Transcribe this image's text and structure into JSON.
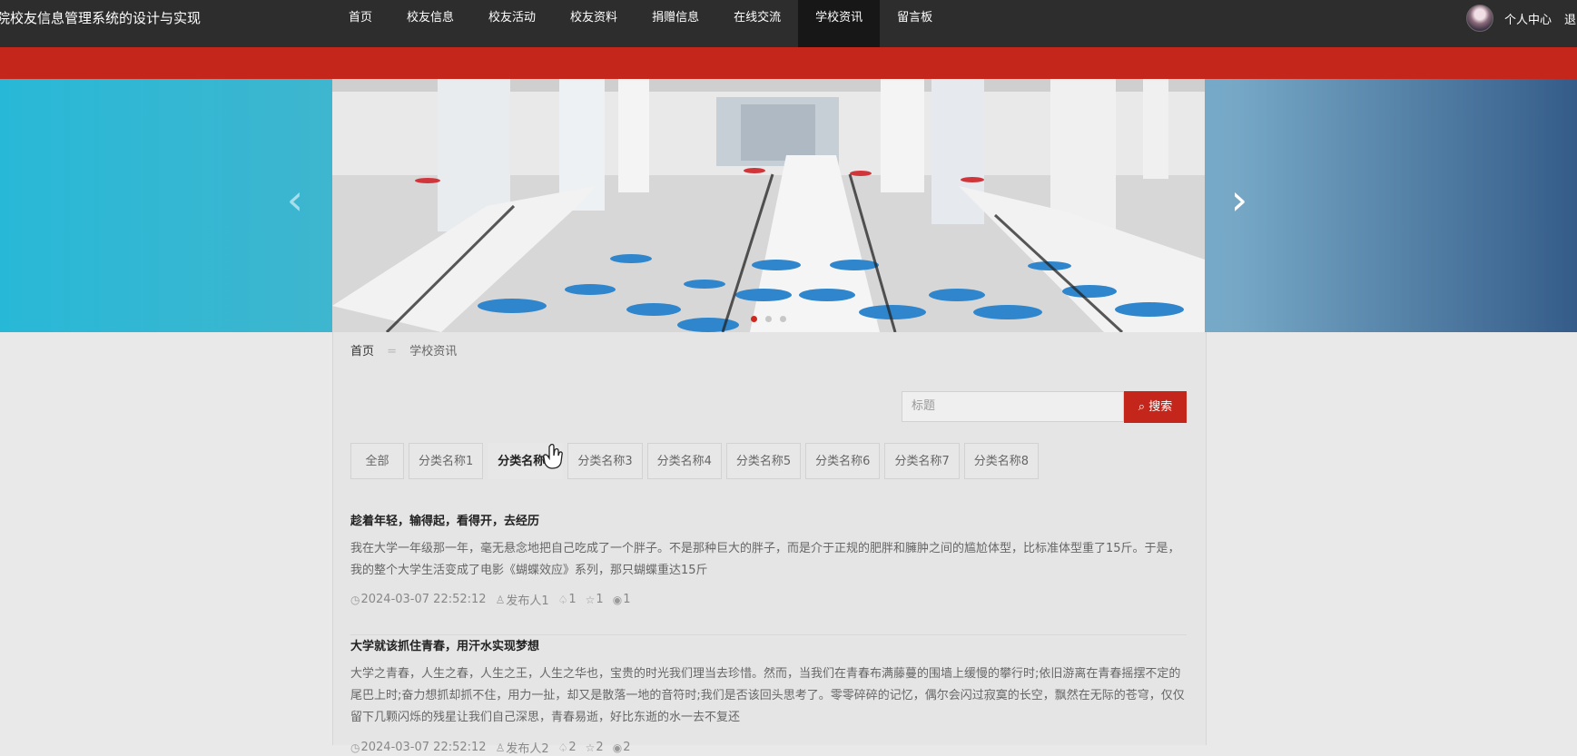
{
  "header": {
    "app_title": "院校友信息管理系统的设计与实现",
    "nav": [
      {
        "label": "首页"
      },
      {
        "label": "校友信息"
      },
      {
        "label": "校友活动"
      },
      {
        "label": "校友资料"
      },
      {
        "label": "捐赠信息"
      },
      {
        "label": "在线交流"
      },
      {
        "label": "学校资讯"
      },
      {
        "label": "留言板"
      }
    ],
    "active_nav": "学校资讯",
    "user_center": "个人中心",
    "logout": "退"
  },
  "carousel": {
    "prev_icon": "chevron-left-icon",
    "next_icon": "chevron-right-icon",
    "active_slide": 1,
    "slide_count": 3
  },
  "breadcrumb": {
    "home": "首页",
    "separator": "=",
    "current": "学校资讯"
  },
  "search": {
    "placeholder": "标题",
    "button_label": "搜索",
    "icon": "search-icon"
  },
  "categories": [
    {
      "label": "全部"
    },
    {
      "label": "分类名称1"
    },
    {
      "label": "分类名称2"
    },
    {
      "label": "分类名称3"
    },
    {
      "label": "分类名称4"
    },
    {
      "label": "分类名称5"
    },
    {
      "label": "分类名称6"
    },
    {
      "label": "分类名称7"
    },
    {
      "label": "分类名称8"
    }
  ],
  "articles": [
    {
      "title": "趁着年轻，输得起，看得开，去经历",
      "desc": "我在大学一年级那一年，毫无悬念地把自己吃成了一个胖子。不是那种巨大的胖子，而是介于正规的肥胖和臃肿之间的尴尬体型，比标准体型重了15斤。于是，我的整个大学生活变成了电影《蝴蝶效应》系列，那只蝴蝶重达15斤",
      "date": "2024-03-07 22:52:12",
      "author": "发布人1",
      "likes": "1",
      "favorites": "1",
      "views": "1"
    },
    {
      "title": "大学就该抓住青春，用汗水实现梦想",
      "desc": "大学之青春，人生之春，人生之王，人生之华也，宝贵的时光我们理当去珍惜。然而，当我们在青春布满藤蔓的围墙上缓慢的攀行时;依旧游离在青春摇摆不定的尾巴上时;奋力想抓却抓不住，用力一扯，却又是散落一地的音符时;我们是否该回头思考了。零零碎碎的记忆，偶尔会闪过寂寞的长空，飘然在无际的苍穹，仅仅留下几颗闪烁的残星让我们自己深思，青春易逝，好比东逝的水一去不复还",
      "date": "2024-03-07 22:52:12",
      "author": "发布人2",
      "likes": "2",
      "favorites": "2",
      "views": "2"
    }
  ],
  "colors": {
    "topbar": "#2d2d2d",
    "accent": "#c4261b",
    "page_bg": "#e9e9e9"
  }
}
